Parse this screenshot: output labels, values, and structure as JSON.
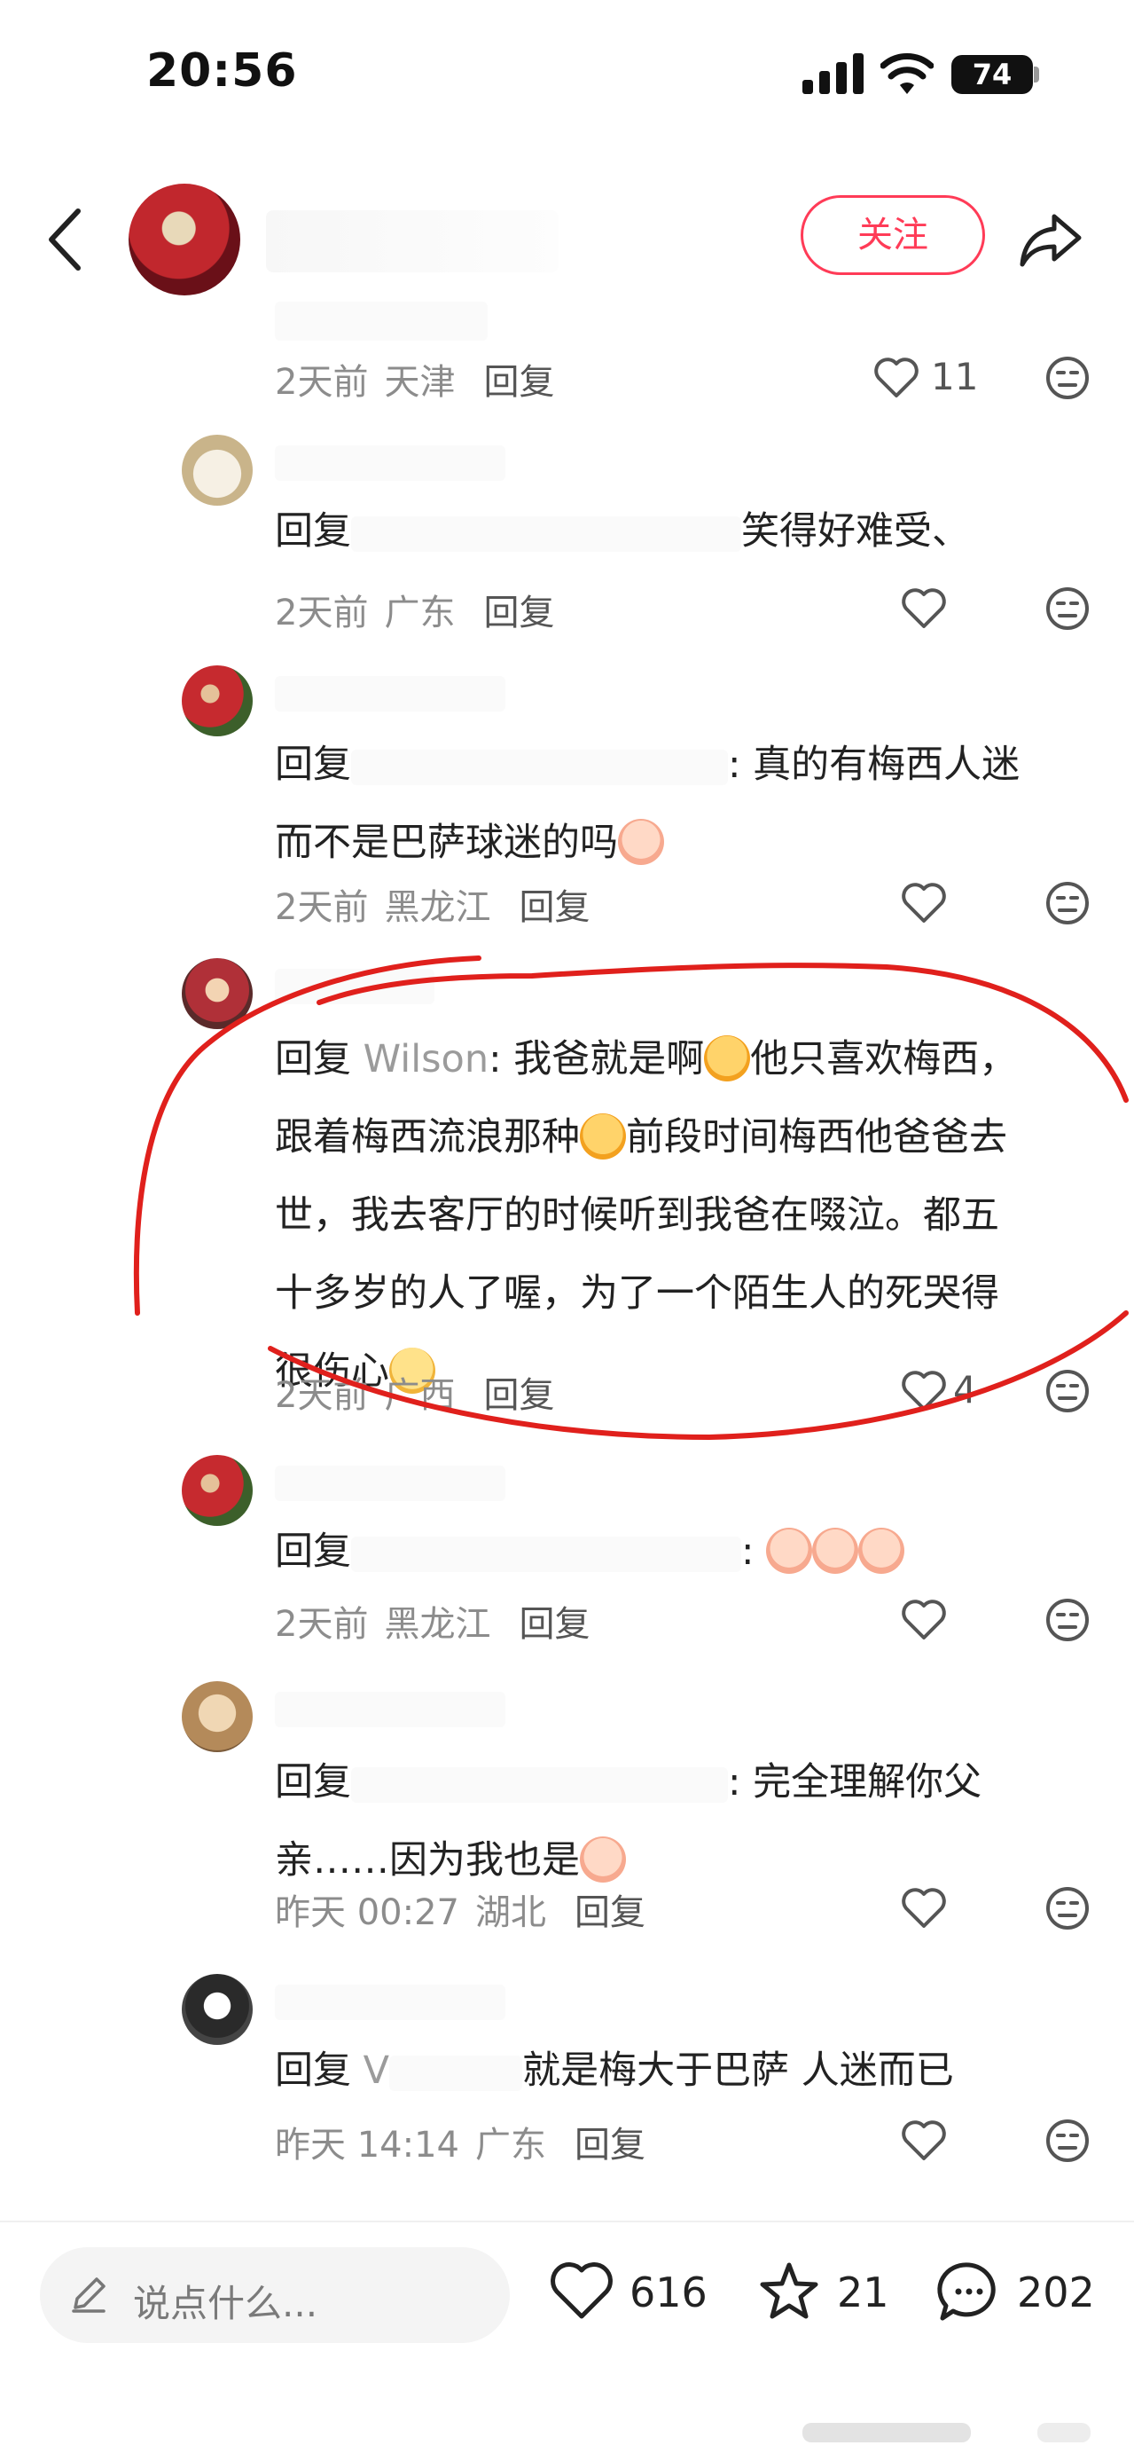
{
  "status_bar": {
    "time": "20:56",
    "battery": "74"
  },
  "header": {
    "follow_label": "关注"
  },
  "comments": [
    {
      "meta_date": "2天前",
      "meta_location": "天津",
      "reply_label": "回复",
      "likes": "11"
    },
    {
      "reply_prefix": "回复",
      "text_after": "笑得好难受、",
      "meta_date": "2天前",
      "meta_location": "广东",
      "reply_label": "回复"
    },
    {
      "reply_prefix": "回复",
      "text_line1_after": "真的有梅西人迷",
      "text_line2": "而不是巴萨球迷的吗",
      "meta_date": "2天前",
      "meta_location": "黑龙江",
      "reply_label": "回复"
    },
    {
      "reply_prefix": "回复",
      "reply_target": "Wilson",
      "line1": "我爸就是啊",
      "line1b": "他只喜欢梅西，",
      "line2a": "跟着梅西流浪那种",
      "line2b": "前段时间梅西他爸爸去",
      "line3": "世，我去客厅的时候听到我爸在啜泣。都五",
      "line4": "十多岁的人了喔，为了一个陌生人的死哭得",
      "line5": "很伤心",
      "meta_date": "2天前",
      "meta_location": "广西",
      "reply_label": "回复",
      "likes": "4"
    },
    {
      "reply_prefix": "回复",
      "meta_date": "2天前",
      "meta_location": "黑龙江",
      "reply_label": "回复"
    },
    {
      "reply_prefix": "回复",
      "text_line1_after": "完全理解你父",
      "text_line2": "亲……因为我也是",
      "meta_date": "昨天 00:27",
      "meta_location": "湖北",
      "reply_label": "回复"
    },
    {
      "reply_prefix": "回复",
      "reply_target": "V",
      "text_after": "就是梅大于巴萨 人迷而已",
      "meta_date": "昨天 14:14",
      "meta_location": "广东",
      "reply_label": "回复"
    }
  ],
  "bottom_bar": {
    "input_placeholder": "说点什么...",
    "likes": "616",
    "stars": "21",
    "comments": "202"
  },
  "colors": {
    "accent": "#ff3b57",
    "annotation": "#e0201c"
  }
}
